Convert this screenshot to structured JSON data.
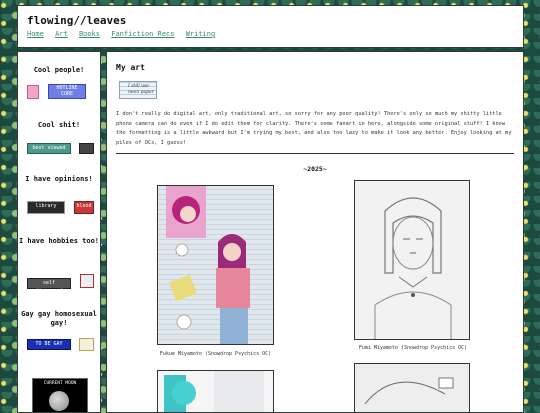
{
  "site": {
    "title": "flowing//leaves",
    "nav": [
      "Home",
      "Art",
      "Books",
      "Fanfiction Recs",
      "Writing"
    ]
  },
  "sidebar": {
    "sections": [
      {
        "heading": "Cool people!",
        "buttons": [
          "HOTLINE CORE"
        ]
      },
      {
        "heading": "Cool shit!",
        "buttons": [
          "best viewed"
        ]
      },
      {
        "heading": "I have opinions!",
        "buttons": [
          "library",
          "blood"
        ]
      },
      {
        "heading": "I have hobbies too!",
        "buttons": [
          "self diagnosed"
        ]
      },
      {
        "heading": "Gay gay homosexual gay!",
        "buttons": [
          "TO BE GAY"
        ]
      }
    ],
    "moon_label": "CURRENT MOON"
  },
  "main": {
    "heading": "My art",
    "stamp_text": "I still use neon paper",
    "intro": "I don't really do digital art, only traditional art, so sorry for any poor quality! There's only so much my shitty little phone camera can do even if I do edit them for clarity. There's some fanart in here, alongside some original stuff! I know the formatting is a little awkward but I'm trying my best, and also too lazy to make it look any better. Enjoy looking at my piles of OCs, I guess!",
    "year": "~2025~",
    "artworks": [
      {
        "caption": "Fukue Miyamoto (Snowdrop Psychics OC)"
      },
      {
        "caption": "Fumi Miyamoto (Snowdrop Psychics OC)"
      }
    ]
  },
  "colors": {
    "link": "#3a8c6e",
    "background": "#1d4a3e",
    "panel": "#ffffff"
  }
}
